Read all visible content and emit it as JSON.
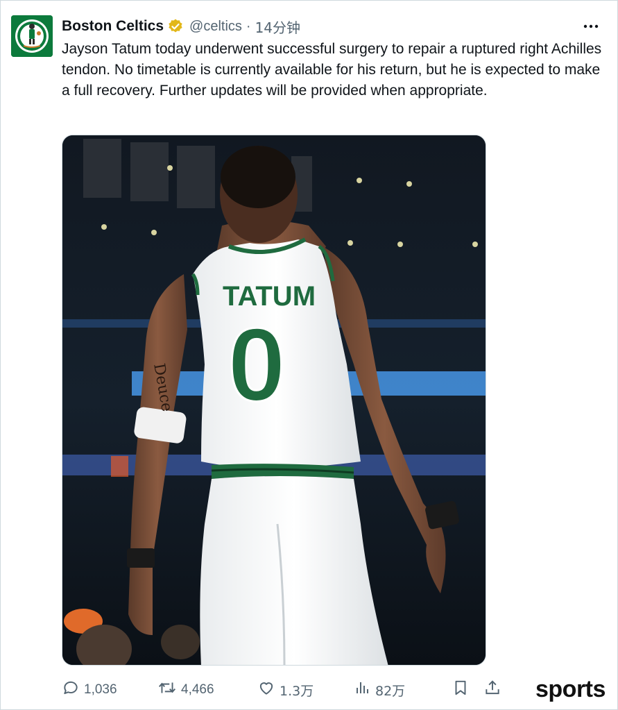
{
  "tweet": {
    "author_name": "Boston Celtics",
    "verified_icon": "gold-verified-badge-icon",
    "handle": "@celtics",
    "separator": "·",
    "time": "14分钟",
    "more_icon": "more-dots-icon",
    "text": "Jayson Tatum today underwent successful surgery to repair a ruptured right Achilles tendon. No timetable is currently available for his return, but he is expected to make a full recovery. Further updates will be provided when appropriate.",
    "media": {
      "jersey_name": "TATUM",
      "jersey_number": "0",
      "tattoo_text": "Deuce"
    }
  },
  "actions": {
    "replies": "1,036",
    "retweets": "4,466",
    "likes": "1.3万",
    "views": "82万"
  },
  "watermark": "sports",
  "colors": {
    "text": "#0f1419",
    "secondary": "#536471",
    "border": "#cfd9de",
    "badge": "#e2b719",
    "celtics_green": "#0c7a3c",
    "jersey_green": "#1f6b3f"
  }
}
